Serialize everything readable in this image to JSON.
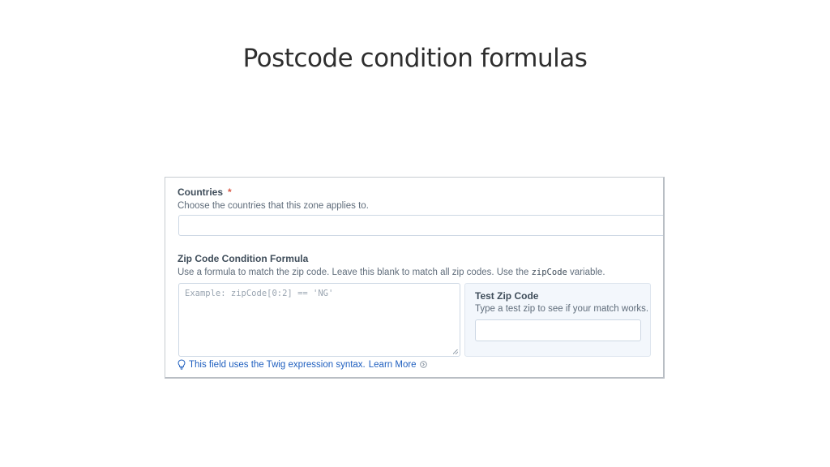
{
  "slide": {
    "title": "Postcode condition formulas"
  },
  "form": {
    "countries": {
      "label": "Countries",
      "required_marker": "*",
      "instructions": "Choose the countries that this zone applies to.",
      "value": ""
    },
    "zip_formula": {
      "label": "Zip Code Condition Formula",
      "instructions_before": "Use a formula to match the zip code. Leave this blank to match all zip codes. Use the ",
      "instructions_code": "zipCode",
      "instructions_after": " variable.",
      "placeholder": "Example: zipCode[0:2] == 'NG'",
      "value": ""
    },
    "test_zip": {
      "label": "Test Zip Code",
      "instructions": "Type a test zip to see if your match works.",
      "value": ""
    },
    "tip": {
      "text": "This field uses the Twig expression syntax.",
      "link": "Learn More"
    }
  },
  "colors": {
    "required": "#da5a47",
    "link": "#1f5fbf",
    "panel_bg": "#f3f7fc",
    "input_border": "#cdd8e4"
  },
  "icons": {
    "tip": "lightbulb-icon",
    "link": "external-arrow-icon"
  }
}
